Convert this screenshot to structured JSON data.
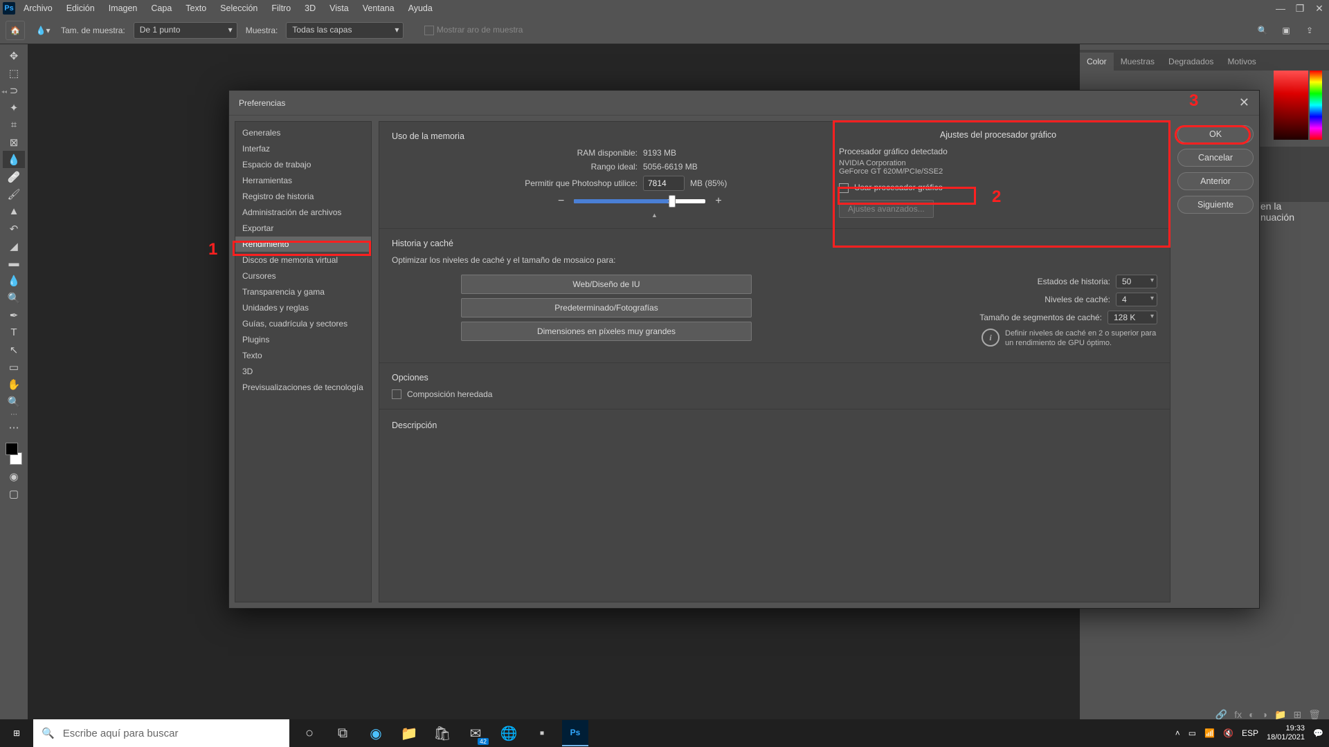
{
  "menubar": {
    "items": [
      "Archivo",
      "Edición",
      "Imagen",
      "Capa",
      "Texto",
      "Selección",
      "Filtro",
      "3D",
      "Vista",
      "Ventana",
      "Ayuda"
    ]
  },
  "optbar": {
    "sample_size_label": "Tam. de muestra:",
    "sample_size_value": "De 1 punto",
    "sample_label": "Muestra:",
    "sample_value": "Todas las capas",
    "ring_label": "Mostrar aro de muestra"
  },
  "panel_tabs": {
    "color": "Color",
    "swatches": "Muestras",
    "gradients": "Degradados",
    "patterns": "Motivos"
  },
  "right_peek": {
    "line1": "en la",
    "line2": "nuación"
  },
  "dialog": {
    "title": "Preferencias",
    "sidebar": [
      "Generales",
      "Interfaz",
      "Espacio de trabajo",
      "Herramientas",
      "Registro de historia",
      "Administración de archivos",
      "Exportar",
      "Rendimiento",
      "Discos de memoria virtual",
      "Cursores",
      "Transparencia y gama",
      "Unidades y reglas",
      "Guías, cuadrícula y sectores",
      "Plugins",
      "Texto",
      "3D",
      "Previsualizaciones de tecnología"
    ],
    "selected_index": 7,
    "buttons": {
      "ok": "OK",
      "cancel": "Cancelar",
      "prev": "Anterior",
      "next": "Siguiente"
    },
    "memory": {
      "title": "Uso de la memoria",
      "ram_label": "RAM disponible:",
      "ram_value": "9193 MB",
      "ideal_label": "Rango ideal:",
      "ideal_value": "5056-6619 MB",
      "allow_label": "Permitir que Photoshop utilice:",
      "allow_value": "7814",
      "allow_suffix": "MB (85%)",
      "slider_percent": 72
    },
    "gpu": {
      "title": "Ajustes del procesador gráfico",
      "detected": "Procesador gráfico detectado",
      "vendor": "NVIDIA Corporation",
      "model": "GeForce GT 620M/PCIe/SSE2",
      "use_label": "Usar procesador gráfico",
      "advanced": "Ajustes avanzados..."
    },
    "history": {
      "title": "Historia y caché",
      "optimize": "Optimizar los niveles de caché y el tamaño de mosaico para:",
      "preset1": "Web/Diseño de IU",
      "preset2": "Predeterminado/Fotografías",
      "preset3": "Dimensiones en píxeles muy grandes",
      "states_label": "Estados de historia:",
      "states_value": "50",
      "levels_label": "Niveles de caché:",
      "levels_value": "4",
      "tile_label": "Tamaño de segmentos de caché:",
      "tile_value": "128 K",
      "hint": "Definir niveles de caché en 2 o superior para un rendimiento de GPU óptimo."
    },
    "options": {
      "title": "Opciones",
      "legacy": "Composición heredada"
    },
    "desc": {
      "title": "Descripción"
    }
  },
  "annotations": {
    "a1": "1",
    "a2": "2",
    "a3": "3"
  },
  "taskbar": {
    "search_placeholder": "Escribe aquí para buscar",
    "lang": "ESP",
    "time": "19:33",
    "date": "18/01/2021",
    "mail_badge": "42"
  }
}
